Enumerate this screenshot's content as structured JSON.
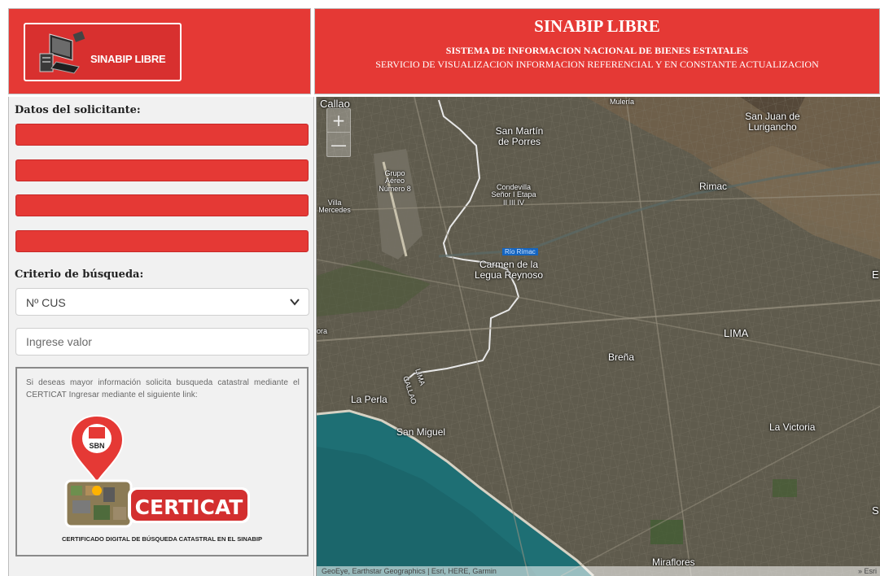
{
  "header": {
    "logo_text": "SINABIP LIBRE",
    "title": "SINABIP LIBRE",
    "subtitle_1": "SISTEMA DE INFORMACION NACIONAL DE BIENES ESTATALES",
    "subtitle_2": "SERVICIO DE VISUALIZACION INFORMACION REFERENCIAL Y EN CONSTANTE ACTUALIZACION"
  },
  "form": {
    "applicant_label": "Datos del solicitante:",
    "search_criteria_label": "Criterio de búsqueda:",
    "search_criteria_selected": "Nº CUS",
    "value_placeholder": "Ingrese valor",
    "info_text": "Si deseas mayor información solicita busqueda catastral mediante el CERTICAT Ingresar mediante el siguiente link:",
    "certicat_badge": "SBN",
    "certicat_name": "CERTICAT",
    "certicat_caption": "CERTIFICADO DIGITAL DE BÚSQUEDA CATASTRAL EN EL SINABIP"
  },
  "map": {
    "zoom_in": "+",
    "zoom_out": "—",
    "labels": {
      "callao": "Callao",
      "muleria": "Mulería",
      "san_martin": "San Martín de Porres",
      "san_juan": "San Juan de Lurigancho",
      "grupo_aereo": "Grupo Aéreo Número 8",
      "condevilla": "Condevilla Señor I Etapa II III IV",
      "rimac": "Rimac",
      "villa_mercedes": "Villa Mercedes",
      "rio_rimac": "Río Rímac",
      "carmen_legua": "Carmen de la Legua Reynoso",
      "lima": "LIMA",
      "brena": "Breña",
      "la_perla": "La Perla",
      "callao_road": "CALLAO",
      "lima_road": "LIMA",
      "san_miguel": "San Miguel",
      "la_victoria": "La Victoria",
      "miraflores": "Miraflores",
      "edge_e": "E",
      "edge_s": "S",
      "edge_ra": "ora"
    },
    "attribution": "GeoEye, Earthstar Geographics | Esri, HERE, Garmin",
    "attribution_right": "» Esri"
  },
  "colors": {
    "brand_red": "#e53935",
    "panel_bg": "#f1f1f1",
    "sea": "#1e6f74"
  }
}
